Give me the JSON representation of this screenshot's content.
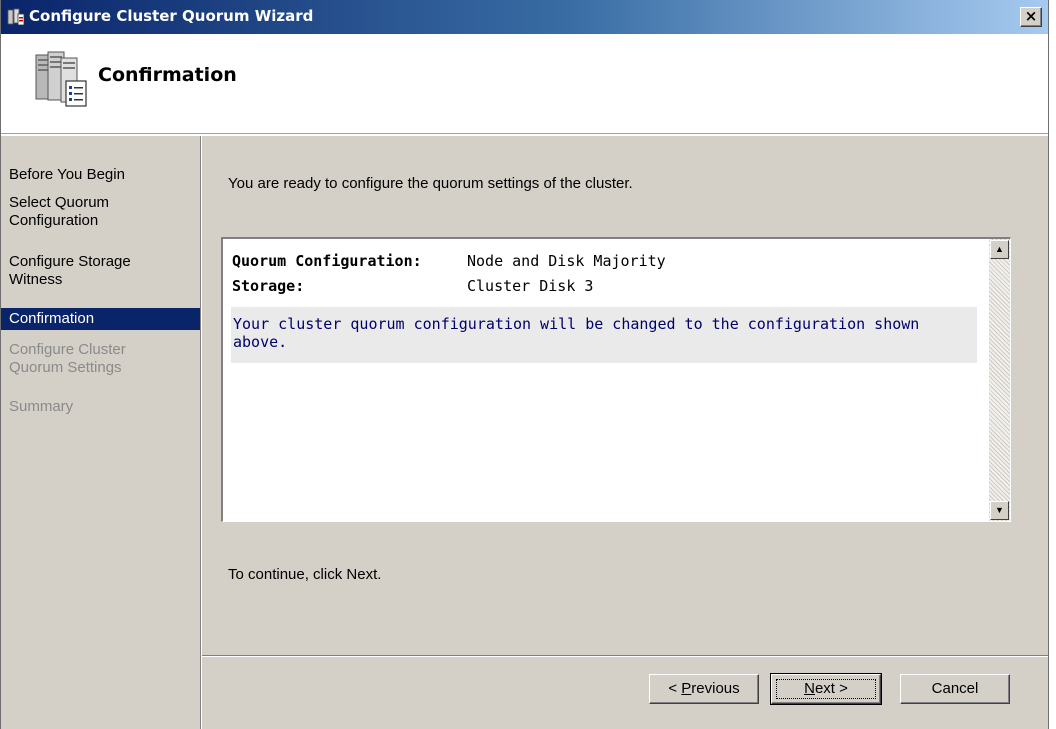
{
  "window": {
    "title": "Configure Cluster Quorum Wizard",
    "close_symbol": "×"
  },
  "header": {
    "title": "Confirmation"
  },
  "nav": {
    "items": [
      {
        "line1": "Before You Begin",
        "line2": "",
        "state": "completed"
      },
      {
        "line1": "Select Quorum",
        "line2": "Configuration",
        "state": "completed"
      },
      {
        "line1": "Configure Storage",
        "line2": "Witness",
        "state": "completed"
      },
      {
        "line1": "Confirmation",
        "line2": "",
        "state": "active"
      },
      {
        "line1": "Configure Cluster",
        "line2": "Quorum Settings",
        "state": "disabled"
      },
      {
        "line1": "Summary",
        "line2": "",
        "state": "disabled"
      }
    ]
  },
  "content": {
    "intro": "You are ready to configure the quorum settings of the cluster.",
    "report": {
      "rows": [
        {
          "label": "Quorum Configuration:",
          "value": "Node and Disk Majority"
        },
        {
          "label": "Storage:",
          "value": "Cluster Disk 3"
        }
      ],
      "note_line1": "Your cluster quorum configuration will be changed to the configuration shown",
      "note_line2": "above."
    },
    "continue_text": "To continue, click Next."
  },
  "buttons": {
    "previous": {
      "prefix": "< ",
      "access_key": "P",
      "rest": "revious"
    },
    "next": {
      "access_key": "N",
      "rest": "ext >"
    },
    "cancel": "Cancel"
  },
  "colors": {
    "selection": "#0a246a",
    "note_text": "#00006a",
    "disabled_text": "#8a8a8a"
  }
}
